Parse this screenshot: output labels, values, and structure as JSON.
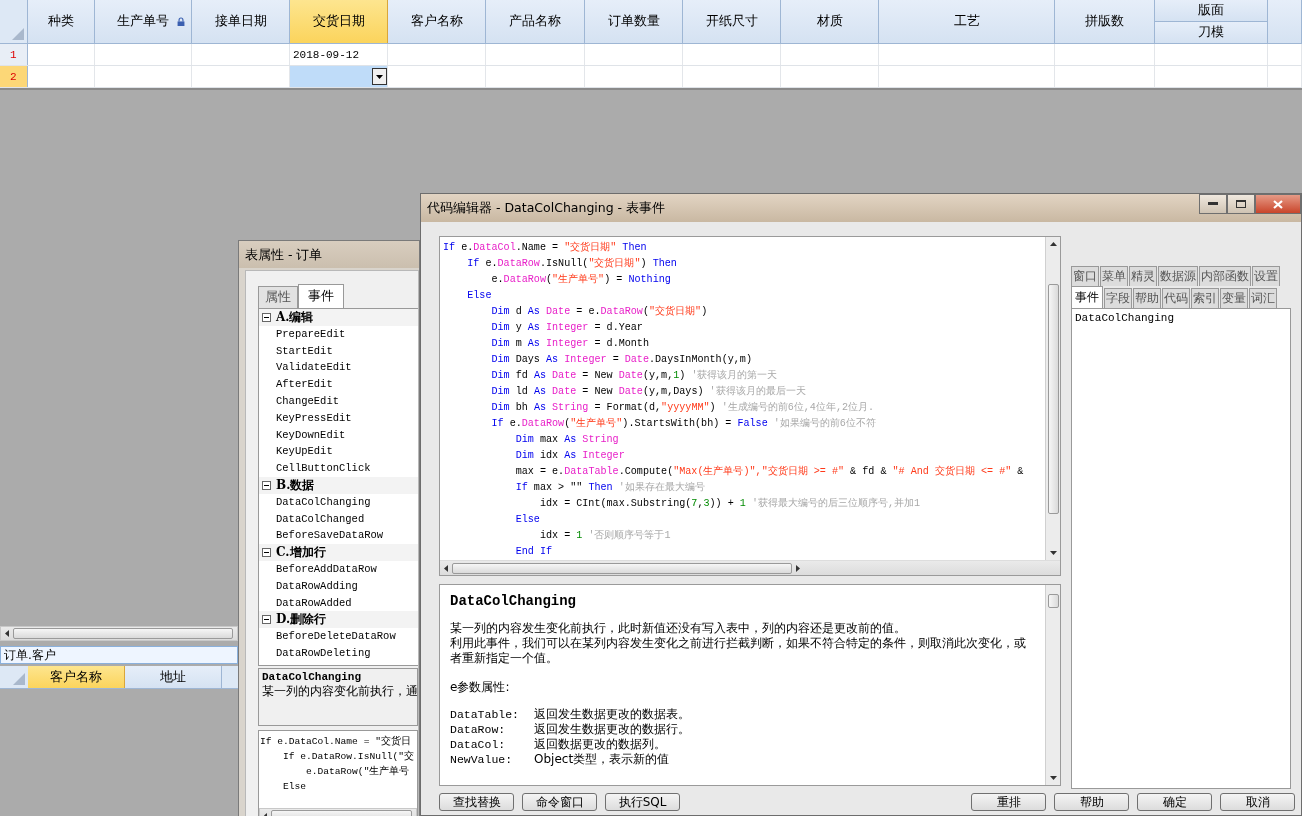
{
  "grid": {
    "columns": [
      {
        "kind": "single",
        "label": "种类",
        "selected": false,
        "locked": false
      },
      {
        "kind": "single",
        "label": "生产单号",
        "selected": false,
        "locked": true
      },
      {
        "kind": "single",
        "label": "接单日期",
        "selected": false,
        "locked": false
      },
      {
        "kind": "single",
        "label": "交货日期",
        "selected": true,
        "locked": false
      },
      {
        "kind": "single",
        "label": "客户名称",
        "selected": false,
        "locked": false
      },
      {
        "kind": "single",
        "label": "产品名称",
        "selected": false,
        "locked": false
      },
      {
        "kind": "single",
        "label": "订单数量",
        "selected": false,
        "locked": false
      },
      {
        "kind": "single",
        "label": "开纸尺寸",
        "selected": false,
        "locked": false
      },
      {
        "kind": "single",
        "label": "材质",
        "selected": false,
        "locked": false
      },
      {
        "kind": "single",
        "label": "工艺",
        "selected": false,
        "locked": false
      },
      {
        "kind": "single",
        "label": "拼版数",
        "selected": false,
        "locked": false
      },
      {
        "kind": "stacked",
        "labels": [
          "版面",
          "刀模"
        ],
        "selected": false
      },
      {
        "kind": "blank",
        "selected": false
      }
    ],
    "rows": [
      {
        "number": "1",
        "selected": false,
        "delivery_date": "2018-09-12",
        "editing": false
      },
      {
        "number": "2",
        "selected": true,
        "editing": true
      }
    ]
  },
  "sub_grid": {
    "field_value": "订单.客户",
    "columns": [
      {
        "label": "客户名称",
        "selected": true
      },
      {
        "label": "地址",
        "selected": false
      }
    ]
  },
  "properties_window": {
    "title": "表属性 - 订单",
    "tabs": [
      {
        "label": "属性",
        "selected": false
      },
      {
        "label": "事件",
        "selected": true
      }
    ],
    "tree": [
      {
        "label": "A.编辑",
        "expanded": true,
        "children": [
          "PrepareEdit",
          "StartEdit",
          "ValidateEdit",
          "AfterEdit",
          "ChangeEdit",
          "KeyPressEdit",
          "KeyDownEdit",
          "KeyUpEdit",
          "CellButtonClick"
        ]
      },
      {
        "label": "B.数据",
        "expanded": true,
        "children": [
          "DataColChanging",
          "DataColChanged",
          "BeforeSaveDataRow"
        ]
      },
      {
        "label": "C.增加行",
        "expanded": true,
        "children": [
          "BeforeAddDataRow",
          "DataRowAdding",
          "DataRowAdded"
        ]
      },
      {
        "label": "D.删除行",
        "expanded": true,
        "children": [
          "BeforeDeleteDataRow",
          "DataRowDeleting"
        ]
      }
    ],
    "description_title": "DataColChanging",
    "description": "某一列的内容变化前执行，通",
    "code_preview": [
      "If e.DataCol.Name = \"交货日",
      "    If e.DataRow.IsNull(\"交",
      "        e.DataRow(\"生产单号",
      "    Else"
    ]
  },
  "editor_window": {
    "title": "代码编辑器 - DataColChanging - 表事件",
    "code": [
      {
        "tokens": [
          {
            "kind": "kw",
            "text": "If"
          },
          {
            "kind": "plain",
            "text": " e."
          },
          {
            "kind": "type",
            "text": "DataCol"
          },
          {
            "kind": "plain",
            "text": ".Name = "
          },
          {
            "kind": "str",
            "text": "\"交货日期\""
          },
          {
            "kind": "kw",
            "text": " Then"
          }
        ]
      },
      {
        "tokens": [
          {
            "kind": "kw",
            "text": "    If"
          },
          {
            "kind": "plain",
            "text": " e."
          },
          {
            "kind": "type",
            "text": "DataRow"
          },
          {
            "kind": "plain",
            "text": ".IsNull("
          },
          {
            "kind": "str",
            "text": "\"交货日期\""
          },
          {
            "kind": "plain",
            "text": ") "
          },
          {
            "kind": "kw",
            "text": "Then"
          }
        ]
      },
      {
        "tokens": [
          {
            "kind": "plain",
            "text": "        e."
          },
          {
            "kind": "type",
            "text": "DataRow"
          },
          {
            "kind": "plain",
            "text": "("
          },
          {
            "kind": "str",
            "text": "\"生产单号\""
          },
          {
            "kind": "plain",
            "text": ") = "
          },
          {
            "kind": "kw",
            "text": "Nothing"
          }
        ]
      },
      {
        "tokens": [
          {
            "kind": "kw",
            "text": "    Else"
          }
        ]
      },
      {
        "tokens": [
          {
            "kind": "kw",
            "text": "        Dim"
          },
          {
            "kind": "plain",
            "text": " d "
          },
          {
            "kind": "kw",
            "text": "As"
          },
          {
            "kind": "type",
            "text": " Date"
          },
          {
            "kind": "plain",
            "text": " = e."
          },
          {
            "kind": "type",
            "text": "DataRow"
          },
          {
            "kind": "plain",
            "text": "("
          },
          {
            "kind": "str",
            "text": "\"交货日期\""
          },
          {
            "kind": "plain",
            "text": ")"
          }
        ]
      },
      {
        "tokens": [
          {
            "kind": "kw",
            "text": "        Dim"
          },
          {
            "kind": "plain",
            "text": " y "
          },
          {
            "kind": "kw",
            "text": "As"
          },
          {
            "kind": "type",
            "text": " Integer"
          },
          {
            "kind": "plain",
            "text": " = d.Year"
          }
        ]
      },
      {
        "tokens": [
          {
            "kind": "kw",
            "text": "        Dim"
          },
          {
            "kind": "plain",
            "text": " m "
          },
          {
            "kind": "kw",
            "text": "As"
          },
          {
            "kind": "type",
            "text": " Integer"
          },
          {
            "kind": "plain",
            "text": " = d.Month"
          }
        ]
      },
      {
        "tokens": [
          {
            "kind": "kw",
            "text": "        Dim"
          },
          {
            "kind": "plain",
            "text": " Days "
          },
          {
            "kind": "kw",
            "text": "As"
          },
          {
            "kind": "type",
            "text": " Integer"
          },
          {
            "kind": "plain",
            "text": " = "
          },
          {
            "kind": "type",
            "text": "Date"
          },
          {
            "kind": "plain",
            "text": ".DaysInMonth(y,m)"
          }
        ]
      },
      {
        "tokens": [
          {
            "kind": "kw",
            "text": "        Dim"
          },
          {
            "kind": "plain",
            "text": " fd "
          },
          {
            "kind": "kw",
            "text": "As"
          },
          {
            "kind": "type",
            "text": " Date"
          },
          {
            "kind": "plain",
            "text": " = New "
          },
          {
            "kind": "type",
            "text": "Date"
          },
          {
            "kind": "plain",
            "text": "(y,m,"
          },
          {
            "kind": "num",
            "text": "1"
          },
          {
            "kind": "plain",
            "text": ")"
          },
          {
            "kind": "com",
            "text": " '获得该月的第一天"
          }
        ]
      },
      {
        "tokens": [
          {
            "kind": "kw",
            "text": "        Dim"
          },
          {
            "kind": "plain",
            "text": " ld "
          },
          {
            "kind": "kw",
            "text": "As"
          },
          {
            "kind": "type",
            "text": " Date"
          },
          {
            "kind": "plain",
            "text": " = New "
          },
          {
            "kind": "type",
            "text": "Date"
          },
          {
            "kind": "plain",
            "text": "(y,m,Days)"
          },
          {
            "kind": "com",
            "text": " '获得该月的最后一天"
          }
        ]
      },
      {
        "tokens": [
          {
            "kind": "kw",
            "text": "        Dim"
          },
          {
            "kind": "plain",
            "text": " bh "
          },
          {
            "kind": "kw",
            "text": "As"
          },
          {
            "kind": "type",
            "text": " String"
          },
          {
            "kind": "plain",
            "text": " = Format(d,"
          },
          {
            "kind": "str",
            "text": "\"yyyyMM\""
          },
          {
            "kind": "plain",
            "text": ")"
          },
          {
            "kind": "com",
            "text": " '生成编号的前6位,4位年,2位月."
          }
        ]
      },
      {
        "tokens": [
          {
            "kind": "kw",
            "text": "        If"
          },
          {
            "kind": "plain",
            "text": " e."
          },
          {
            "kind": "type",
            "text": "DataRow"
          },
          {
            "kind": "plain",
            "text": "("
          },
          {
            "kind": "str",
            "text": "\"生产单号\""
          },
          {
            "kind": "plain",
            "text": ").StartsWith(bh) = "
          },
          {
            "kind": "kw",
            "text": "False"
          },
          {
            "kind": "com",
            "text": " '如果编号的前6位不符"
          }
        ]
      },
      {
        "tokens": [
          {
            "kind": "kw",
            "text": "            Dim"
          },
          {
            "kind": "plain",
            "text": " max "
          },
          {
            "kind": "kw",
            "text": "As"
          },
          {
            "kind": "type",
            "text": " String"
          }
        ]
      },
      {
        "tokens": [
          {
            "kind": "kw",
            "text": "            Dim"
          },
          {
            "kind": "plain",
            "text": " idx "
          },
          {
            "kind": "kw",
            "text": "As"
          },
          {
            "kind": "type",
            "text": " Integer"
          }
        ]
      },
      {
        "tokens": [
          {
            "kind": "plain",
            "text": "            max = e."
          },
          {
            "kind": "type",
            "text": "DataTable"
          },
          {
            "kind": "plain",
            "text": ".Compute("
          },
          {
            "kind": "str",
            "text": "\"Max(生产单号)\",\"交货日期 >= #\""
          },
          {
            "kind": "plain",
            "text": " & fd & "
          },
          {
            "kind": "str",
            "text": "\"# And 交货日期 <= #\""
          },
          {
            "kind": "plain",
            "text": " &"
          }
        ]
      },
      {
        "tokens": [
          {
            "kind": "kw",
            "text": "            If"
          },
          {
            "kind": "plain",
            "text": " max > \"\" "
          },
          {
            "kind": "kw",
            "text": "Then"
          },
          {
            "kind": "com",
            "text": " '如果存在最大编号"
          }
        ]
      },
      {
        "tokens": [
          {
            "kind": "plain",
            "text": "                idx = CInt(max.Substring("
          },
          {
            "kind": "num",
            "text": "7"
          },
          {
            "kind": "plain",
            "text": ","
          },
          {
            "kind": "num",
            "text": "3"
          },
          {
            "kind": "plain",
            "text": ")) + "
          },
          {
            "kind": "num",
            "text": "1"
          },
          {
            "kind": "com",
            "text": " '获得最大编号的后三位顺序号,并加1"
          }
        ]
      },
      {
        "tokens": [
          {
            "kind": "kw",
            "text": "            Else"
          }
        ]
      },
      {
        "tokens": [
          {
            "kind": "plain",
            "text": "                idx = "
          },
          {
            "kind": "num",
            "text": "1"
          },
          {
            "kind": "com",
            "text": " '否则顺序号等于1"
          }
        ]
      },
      {
        "tokens": [
          {
            "kind": "kw",
            "text": "            End If"
          }
        ]
      }
    ],
    "help": {
      "title": "DataColChanging",
      "paragraphs": [
        "某一列的内容发生变化前执行，此时新值还没有写入表中，列的内容还是更改前的值。",
        "利用此事件，我们可以在某列内容发生变化之前进行拦截判断，如果不符合特定的条件，则取消此次变化，或者重新指定一个值。"
      ],
      "params_heading": "e参数属性:",
      "params": [
        {
          "name": "DataTable:",
          "text": "返回发生数据更改的数据表。"
        },
        {
          "name": "DataRow:",
          "text": "返回发生数据更改的数据行。"
        },
        {
          "name": "DataCol:",
          "text": "返回数据更改的数据列。"
        },
        {
          "name": "NewValue:",
          "text": "Object类型，表示新的值"
        }
      ]
    },
    "left_buttons": [
      "查找替换",
      "命令窗口",
      "执行SQL"
    ],
    "right_buttons": [
      "重排",
      "帮助",
      "确定",
      "取消"
    ],
    "tab_rows": [
      [
        {
          "label": "窗口",
          "selected": false
        },
        {
          "label": "菜单",
          "selected": false
        },
        {
          "label": "精灵",
          "selected": false
        },
        {
          "label": "数据源",
          "selected": false
        },
        {
          "label": "内部函数",
          "selected": false
        },
        {
          "label": "设置",
          "selected": false
        }
      ],
      [
        {
          "label": "事件",
          "selected": true
        },
        {
          "label": "字段",
          "selected": false
        },
        {
          "label": "帮助",
          "selected": false
        },
        {
          "label": "代码",
          "selected": false
        },
        {
          "label": "索引",
          "selected": false
        },
        {
          "label": "变量",
          "selected": false
        },
        {
          "label": "词汇",
          "selected": false
        }
      ]
    ],
    "list_items": [
      "DataColChanging"
    ]
  }
}
